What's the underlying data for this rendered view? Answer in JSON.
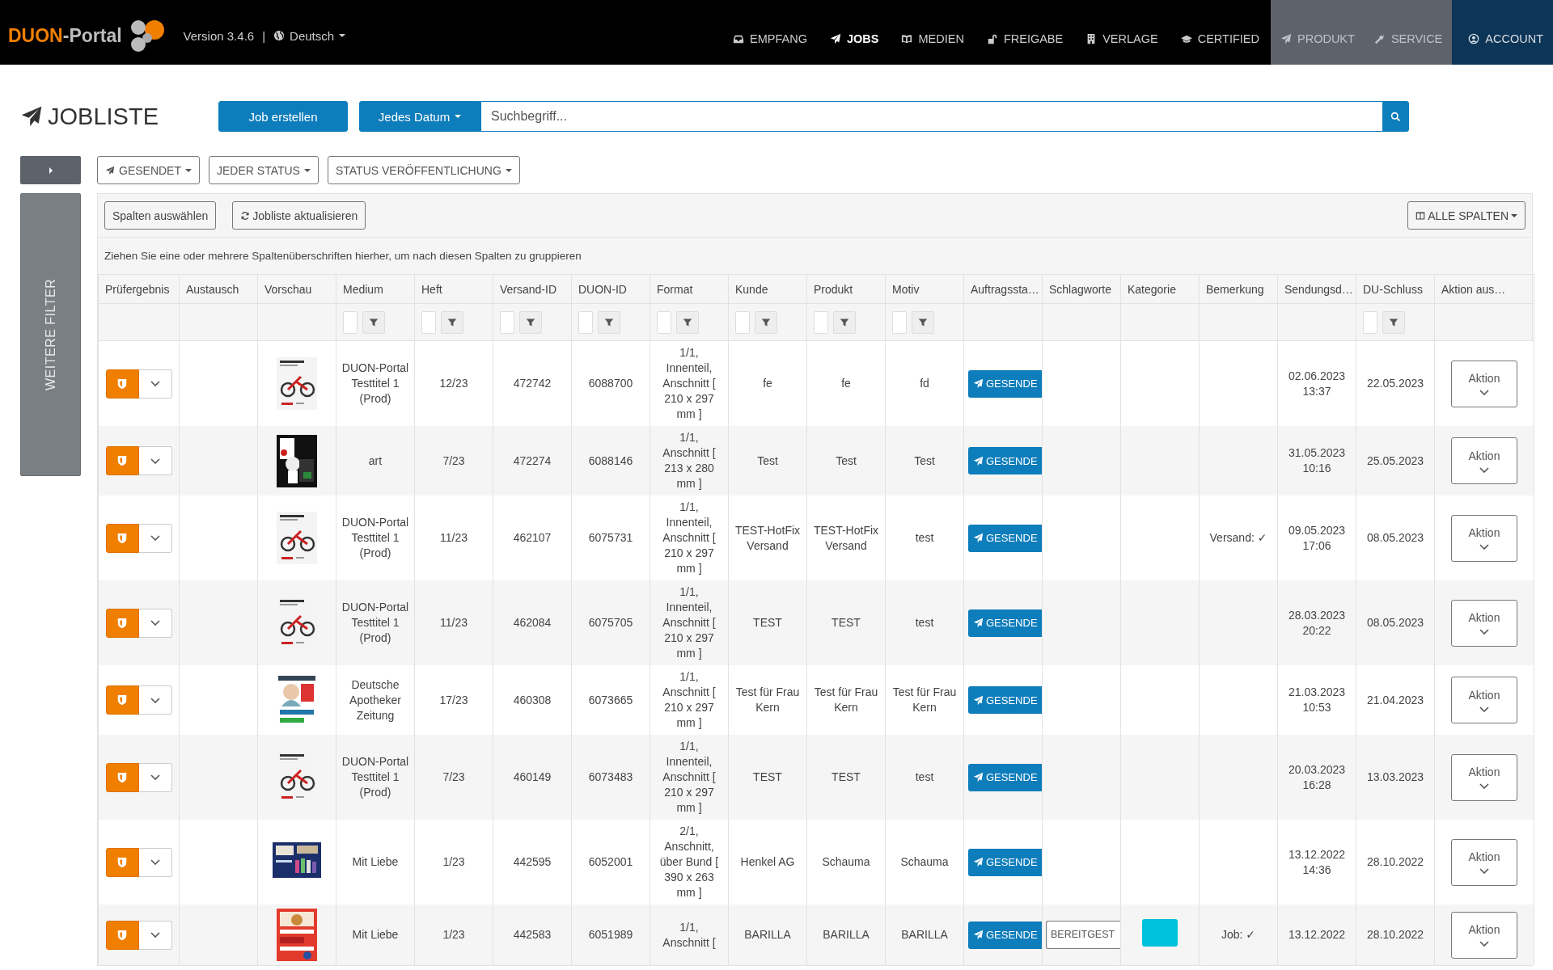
{
  "header": {
    "logo": {
      "parts": [
        "DUON",
        "-Portal"
      ]
    },
    "version": "Version 3.4.6",
    "separator": "|",
    "language": "Deutsch",
    "nav": [
      {
        "label": "EMPFANG",
        "kind": "main",
        "selected": false
      },
      {
        "label": "JOBS",
        "kind": "main",
        "selected": true
      },
      {
        "label": "MEDIEN",
        "kind": "main",
        "selected": false
      },
      {
        "label": "FREIGABE",
        "kind": "main",
        "selected": false
      },
      {
        "label": "VERLAGE",
        "kind": "main",
        "selected": false
      },
      {
        "label": "CERTIFIED",
        "kind": "main",
        "selected": false
      },
      {
        "label": "PRODUKT",
        "kind": "tool",
        "selected": false
      },
      {
        "label": "SERVICE",
        "kind": "tool",
        "selected": false
      },
      {
        "label": "ACCOUNT",
        "kind": "account",
        "selected": false
      }
    ]
  },
  "title": "JOBLISTE",
  "create_button": "Job erstellen",
  "date_filter": "Jedes Datum",
  "search": {
    "placeholder": "Suchbegriff..."
  },
  "filters": [
    "GESENDET",
    "JEDER STATUS",
    "STATUS VERÖFFENTLICHUNG"
  ],
  "sidebar": {
    "panel_label": "WEITERE FILTER"
  },
  "grid": {
    "toolbar": [
      "Spalten auswählen",
      "Jobliste aktualisieren"
    ],
    "columns_menu": "ALLE SPALTEN",
    "group_hint": "Ziehen Sie eine oder mehrere Spaltenüberschriften hierher, um nach diesen Spalten zu gruppieren",
    "columns": [
      {
        "label": "Prüfergebnis",
        "filter": false
      },
      {
        "label": "Austausch",
        "filter": false
      },
      {
        "label": "Vorschau",
        "filter": false
      },
      {
        "label": "Medium",
        "filter": true
      },
      {
        "label": "Heft",
        "filter": true
      },
      {
        "label": "Versand-ID",
        "filter": true
      },
      {
        "label": "DUON-ID",
        "filter": true
      },
      {
        "label": "Format",
        "filter": true
      },
      {
        "label": "Kunde",
        "filter": true
      },
      {
        "label": "Produkt",
        "filter": true
      },
      {
        "label": "Motiv",
        "filter": true
      },
      {
        "label": "Auftragssta…",
        "filter": false
      },
      {
        "label": "Schlagworte",
        "filter": false
      },
      {
        "label": "Kategorie",
        "filter": false
      },
      {
        "label": "Bemerkung",
        "filter": false
      },
      {
        "label": "Sendungsd…",
        "filter": false
      },
      {
        "label": "DU-Schluss",
        "filter": true
      },
      {
        "label": "Aktion aus…",
        "filter": false
      }
    ],
    "rows": [
      {
        "medium": "DUON-Portal Testtitel 1 (Prod)",
        "issue": "12/23",
        "shipping_id": "472742",
        "duon_id": "6088700",
        "format": "1/1, Innenteil, Anschnitt [ 210 x 297 mm ]",
        "customer": "fe",
        "product": "fe",
        "motif": "fd",
        "order_status": "GESENDE",
        "send_date": "02.06.2023 13:37",
        "du_deadline": "22.05.2023",
        "action": "Aktion"
      },
      {
        "medium": "art",
        "issue": "7/23",
        "shipping_id": "472274",
        "duon_id": "6088146",
        "format": "1/1, Anschnitt [ 213 x 280 mm ]",
        "customer": "Test",
        "product": "Test",
        "motif": "Test",
        "order_status": "GESENDE",
        "send_date": "31.05.2023 10:16",
        "du_deadline": "25.05.2023",
        "action": "Aktion"
      },
      {
        "medium": "DUON-Portal Testtitel 1 (Prod)",
        "issue": "11/23",
        "shipping_id": "462107",
        "duon_id": "6075731",
        "format": "1/1, Innenteil, Anschnitt [ 210 x 297 mm ]",
        "customer": "TEST-HotFix Versand",
        "product": "TEST-HotFix Versand",
        "motif": "test",
        "order_status": "GESENDE",
        "remark": "Versand: ✓",
        "send_date": "09.05.2023 17:06",
        "du_deadline": "08.05.2023",
        "action": "Aktion"
      },
      {
        "medium": "DUON-Portal Testtitel 1 (Prod)",
        "issue": "11/23",
        "shipping_id": "462084",
        "duon_id": "6075705",
        "format": "1/1, Innenteil, Anschnitt [ 210 x 297 mm ]",
        "customer": "TEST",
        "product": "TEST",
        "motif": "test",
        "order_status": "GESENDE",
        "send_date": "28.03.2023 20:22",
        "du_deadline": "08.05.2023",
        "action": "Aktion"
      },
      {
        "medium": "Deutsche Apotheker Zeitung",
        "issue": "17/23",
        "shipping_id": "460308",
        "duon_id": "6073665",
        "format": "1/1, Anschnitt [ 210 x 297 mm ]",
        "customer": "Test für Frau Kern",
        "product": "Test für Frau Kern",
        "motif": "Test für Frau Kern",
        "order_status": "GESENDE",
        "send_date": "21.03.2023 10:53",
        "du_deadline": "21.04.2023",
        "action": "Aktion"
      },
      {
        "medium": "DUON-Portal Testtitel 1 (Prod)",
        "issue": "7/23",
        "shipping_id": "460149",
        "duon_id": "6073483",
        "format": "1/1, Innenteil, Anschnitt [ 210 x 297 mm ]",
        "customer": "TEST",
        "product": "TEST",
        "motif": "test",
        "order_status": "GESENDE",
        "send_date": "20.03.2023 16:28",
        "du_deadline": "13.03.2023",
        "action": "Aktion"
      },
      {
        "medium": "Mit Liebe",
        "issue": "1/23",
        "shipping_id": "442595",
        "duon_id": "6052001",
        "format": "2/1, Anschnitt, über Bund [ 390 x 263 mm ]",
        "customer": "Henkel AG",
        "product": "Schauma",
        "motif": "Schauma",
        "order_status": "GESENDE",
        "send_date": "13.12.2022 14:36",
        "du_deadline": "28.10.2022",
        "action": "Aktion"
      },
      {
        "medium": "Mit Liebe",
        "issue": "1/23",
        "shipping_id": "442583",
        "duon_id": "6051989",
        "format": "1/1, Anschnitt [",
        "customer": "BARILLA",
        "product": "BARILLA",
        "motif": "BARILLA",
        "order_status": "GESENDE",
        "keyword": "BEREITGEST",
        "category": {
          "color": "#00c2dc"
        },
        "remark": "Job: ✓",
        "send_date": "13.12.2022",
        "du_deadline": "28.10.2022",
        "action": "Aktion"
      }
    ]
  }
}
